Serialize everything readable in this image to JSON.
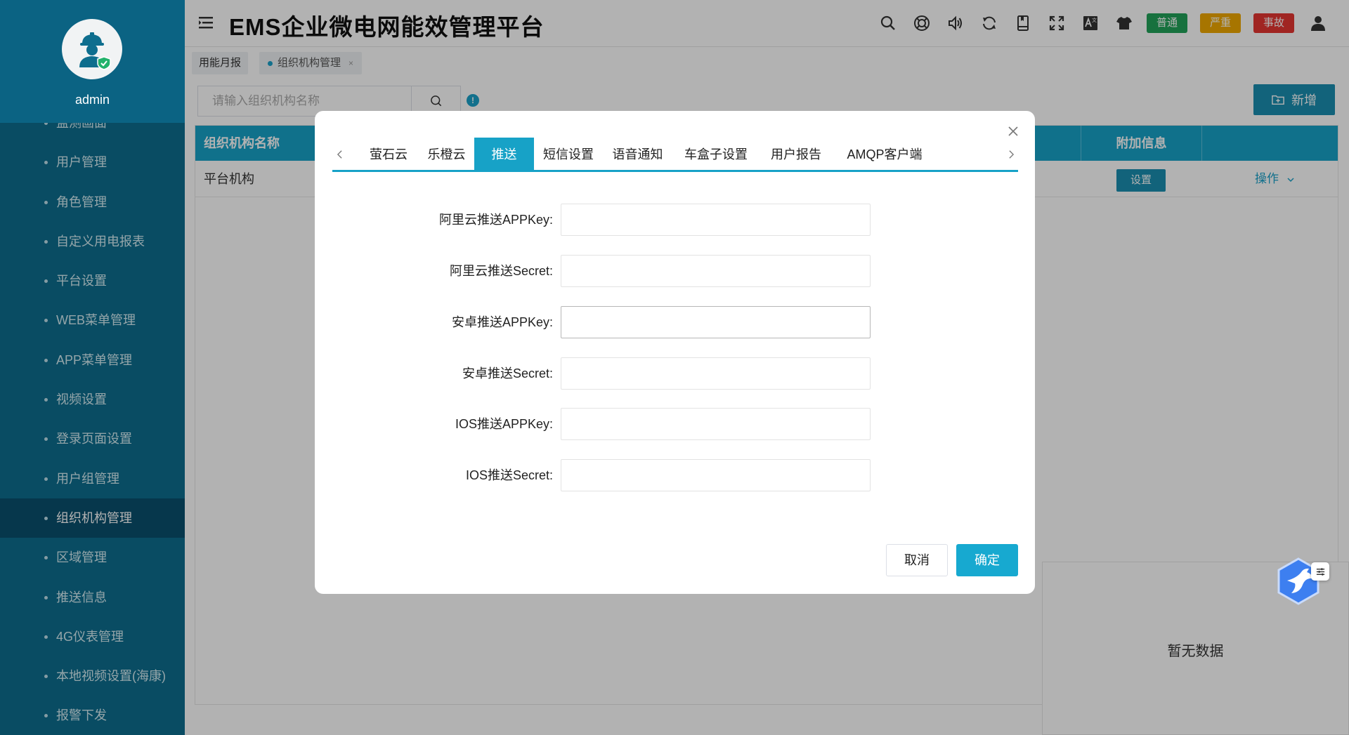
{
  "user": {
    "name": "admin"
  },
  "sidebar": {
    "items": [
      {
        "label": "监测画面"
      },
      {
        "label": "用户管理"
      },
      {
        "label": "角色管理"
      },
      {
        "label": "自定义用电报表"
      },
      {
        "label": "平台设置"
      },
      {
        "label": "WEB菜单管理"
      },
      {
        "label": "APP菜单管理"
      },
      {
        "label": "视频设置"
      },
      {
        "label": "登录页面设置"
      },
      {
        "label": "用户组管理"
      },
      {
        "label": "组织机构管理"
      },
      {
        "label": "区域管理"
      },
      {
        "label": "推送信息"
      },
      {
        "label": "4G仪表管理"
      },
      {
        "label": "本地视频设置(海康)"
      },
      {
        "label": "报警下发"
      }
    ],
    "active_index": 10
  },
  "header": {
    "title": "EMS企业微电网能效管理平台",
    "icons": [
      "search-icon",
      "help-icon",
      "volume-icon",
      "refresh-icon",
      "book-icon",
      "fullscreen-icon",
      "translate-icon",
      "theme-icon",
      "user-icon"
    ],
    "badges": {
      "normal": "普通",
      "serious": "严重",
      "accident": "事故"
    },
    "colors": {
      "normal": "#21a35a",
      "serious": "#f0a800",
      "accident": "#e63631"
    }
  },
  "page_tabs": {
    "tab1": "用能月报",
    "tab2": "组织机构管理",
    "close": "×"
  },
  "toolbar": {
    "search_placeholder": "请输入组织机构名称",
    "add_label": "新增",
    "info": "!"
  },
  "table": {
    "columns": {
      "name": "组织机构名称",
      "extra": "附加信息",
      "ops": ""
    },
    "rows": [
      {
        "name": "平台机构",
        "settings": "设置",
        "operation": "操作"
      }
    ]
  },
  "empty_panel": {
    "text": "暂无数据"
  },
  "modal": {
    "tabs": [
      "萤石云",
      "乐橙云",
      "推送",
      "短信设置",
      "语音通知",
      "车盒子设置",
      "用户报告",
      "AMQP客户端"
    ],
    "active_tab": 2,
    "fields": [
      {
        "label": "阿里云推送APPKey:",
        "value": ""
      },
      {
        "label": "阿里云推送Secret:",
        "value": ""
      },
      {
        "label": "安卓推送APPKey:",
        "value": ""
      },
      {
        "label": "安卓推送Secret:",
        "value": ""
      },
      {
        "label": "IOS推送APPKey:",
        "value": ""
      },
      {
        "label": "IOS推送Secret:",
        "value": ""
      }
    ],
    "cancel_label": "取消",
    "ok_label": "确定"
  },
  "theme": {
    "accent": "#17a2c7",
    "sidebar_bg": "#0e6e8e"
  }
}
